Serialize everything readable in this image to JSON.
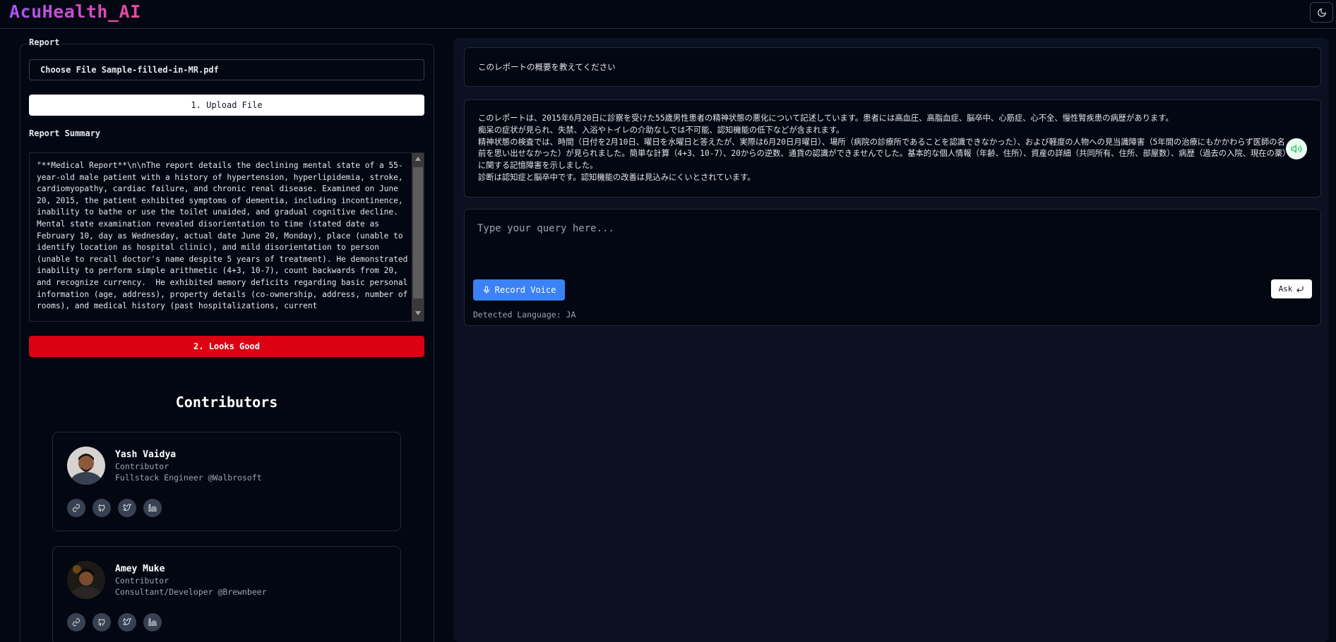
{
  "app": {
    "brand": "AcuHealth_AI"
  },
  "left": {
    "report_legend": "Report",
    "file_input": "Choose File Sample-filled-in-MR.pdf",
    "upload_button": "1. Upload File",
    "summary_label": "Report Summary",
    "summary_text": "\"**Medical Report**\\n\\nThe report details the declining mental state of a 55-year-old male patient with a history of hypertension, hyperlipidemia, stroke, cardiomyopathy, cardiac failure, and chronic renal disease. Examined on June 20, 2015, the patient exhibited symptoms of dementia, including incontinence, inability to bathe or use the toilet unaided, and gradual cognitive decline.  Mental state examination revealed disorientation to time (stated date as February 10, day as Wednesday, actual date June 20, Monday), place (unable to identify location as hospital clinic), and mild disorientation to person (unable to recall doctor's name despite 5 years of treatment). He demonstrated inability to perform simple arithmetic (4+3, 10-7), count backwards from 20, and recognize currency.  He exhibited memory deficits regarding basic personal information (age, address), property details (co-ownership, address, number of rooms), and medical history (past hospitalizations, current",
    "looks_good_button": "2. Looks Good"
  },
  "contributors": {
    "title": "Contributors",
    "people": [
      {
        "name": "Yash Vaidya",
        "role": "Contributor",
        "title": "Fullstack Engineer @Walbrosoft"
      },
      {
        "name": "Amey Muke",
        "role": "Contributor",
        "title": "Consultant/Developer @Brewnbeer"
      }
    ]
  },
  "chat": {
    "query": "このレポートの概要を教えてください",
    "answer_lines": [
      "このレポートは、2015年6月20日に診察を受けた55歳男性患者の精神状態の悪化について記述しています。患者には高血圧、高脂血症、脳卒中、心筋症、心不全、慢性腎疾患の病歴があります。",
      "痴呆の症状が見られ、失禁、入浴やトイレの介助なしでは不可能、認知機能の低下などが含まれます。",
      "精神状態の検査では、時間（日付を2月10日、曜日を水曜日と答えたが、実際は6月20日月曜日）、場所（病院の診療所であることを認識できなかった）、および軽度の人物への見当識障害（5年間の治療にもかかわらず医師の名前を思い出せなかった）が見られました。簡単な計算（4+3、10-7）、20からの逆数、通貨の認識ができませんでした。基本的な個人情報（年齢、住所）、資産の詳細（共同所有、住所、部屋数）、病歴（過去の入院、現在の薬）に関する記憶障害を示しました。",
      "診断は認知症と脳卒中です。認知機能の改善は見込みにくいとされています。"
    ],
    "input_placeholder": "Type your query here...",
    "record_button": "Record Voice",
    "ask_button": "Ask",
    "detected_language": "Detected Language: JA"
  },
  "icons": {
    "theme": "moon-icon",
    "speaker": "volume-icon",
    "record": "microphone-icon",
    "ask": "enter-icon",
    "socials": [
      "link-icon",
      "github-icon",
      "twitter-icon",
      "linkedin-icon"
    ]
  },
  "colors": {
    "background": "#030712",
    "panel": "#0b1120",
    "brand_gradient_start": "#a855f7",
    "brand_gradient_end": "#ec4899",
    "looks_good": "#dc0013",
    "record": "#3b82f6",
    "speaker": "#22c55e"
  }
}
